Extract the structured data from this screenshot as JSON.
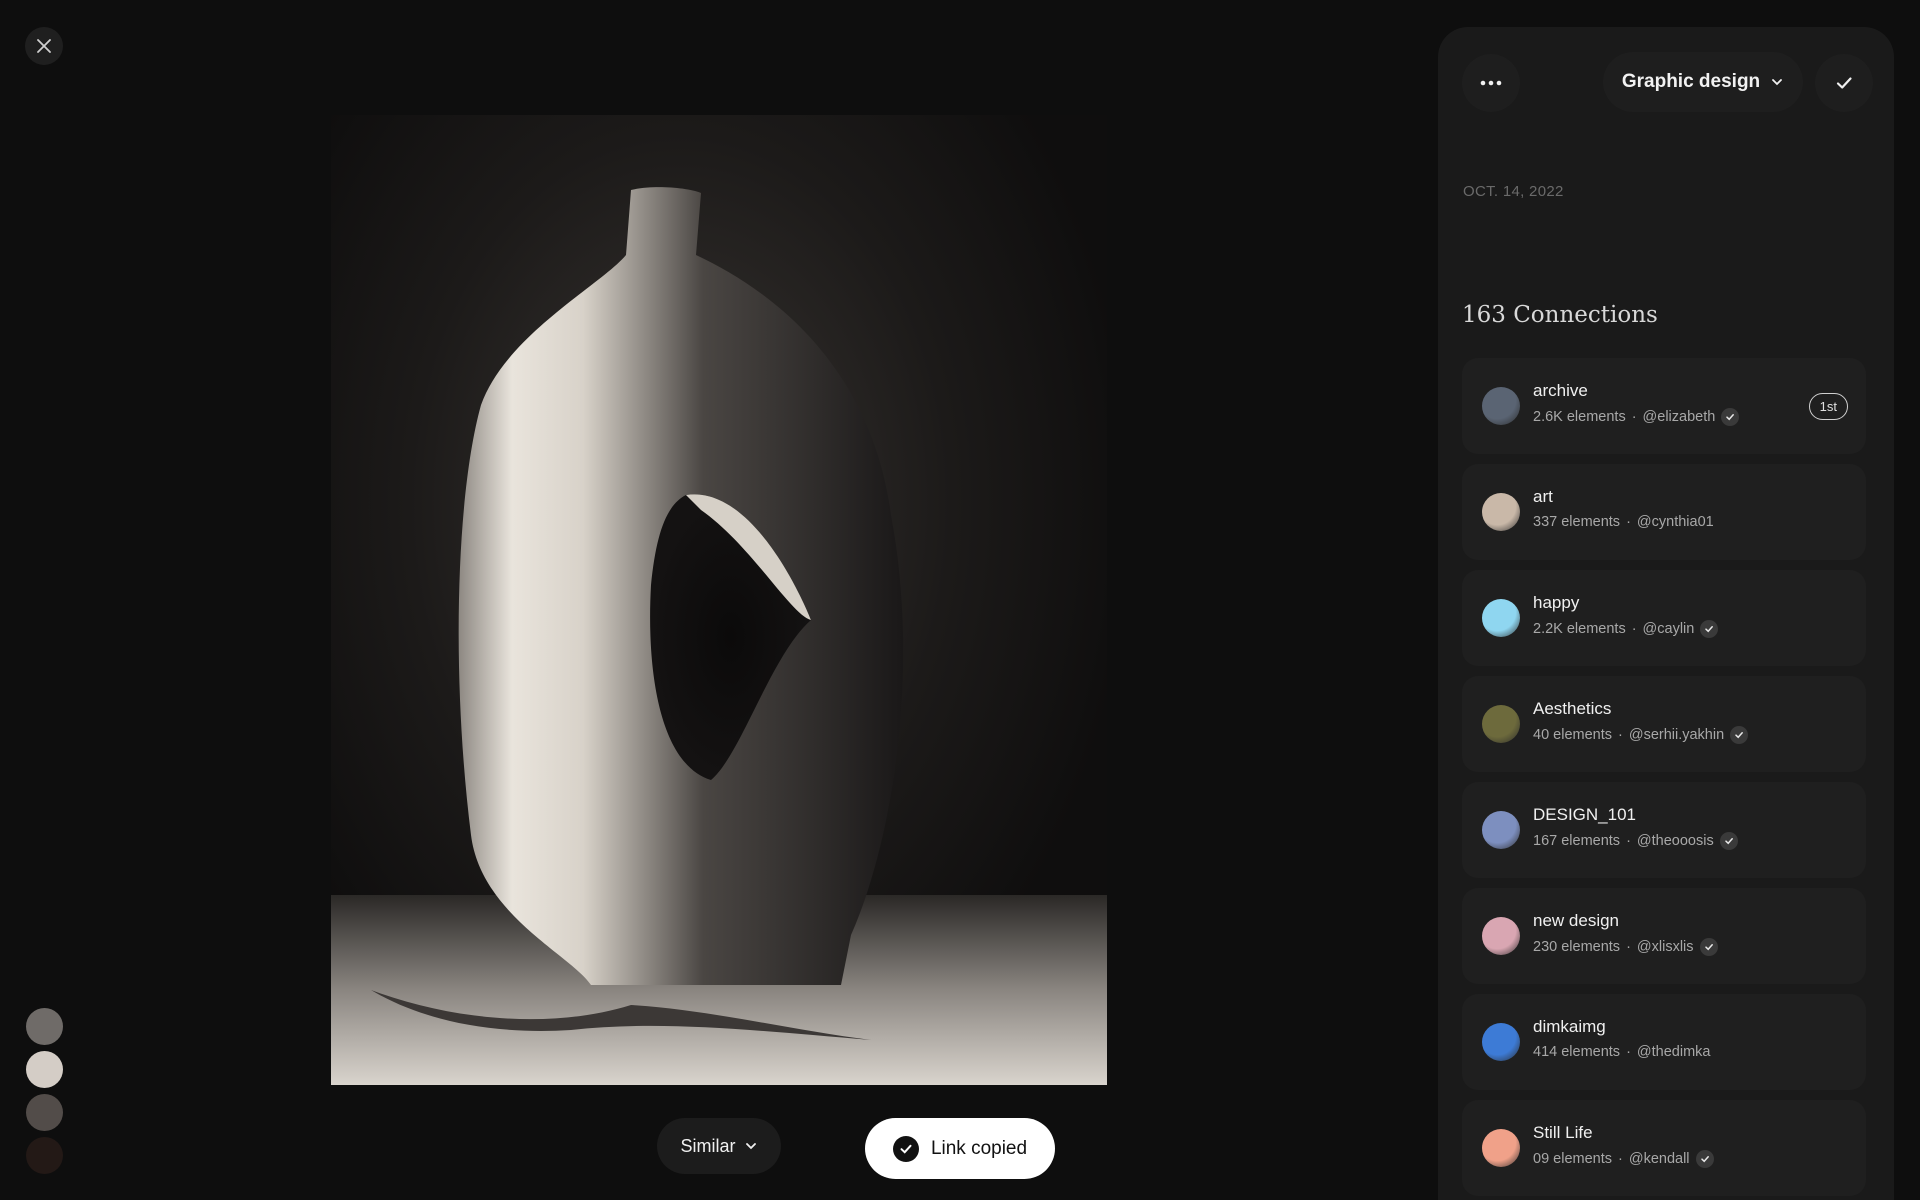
{
  "viewer": {
    "close_icon": "close-icon",
    "swatches": [
      "#6f6b68",
      "#d4cdc6",
      "#524c49",
      "#231916"
    ]
  },
  "actions": {
    "similar_label": "Similar",
    "toast_label": "Link copied"
  },
  "panel": {
    "board_label": "Graphic design",
    "date": "OCT. 14, 2022",
    "connections_heading": "163 Connections",
    "connections": [
      {
        "title": "archive",
        "count": "2.6K elements",
        "user": "@elizabeth",
        "verified": true,
        "badge": "1st",
        "avatar_color": "#5a6473"
      },
      {
        "title": "art",
        "count": "337 elements",
        "user": "@cynthia01",
        "verified": false,
        "badge": "",
        "avatar_color": "#c9b8a8"
      },
      {
        "title": "happy",
        "count": "2.2K elements",
        "user": "@caylin",
        "verified": true,
        "badge": "",
        "avatar_color": "#8fd6f0"
      },
      {
        "title": "Aesthetics",
        "count": "40 elements",
        "user": "@serhii.yakhin",
        "verified": true,
        "badge": "",
        "avatar_color": "#6d6a3c"
      },
      {
        "title": "DESIGN_101",
        "count": "167 elements",
        "user": "@theooosis",
        "verified": true,
        "badge": "",
        "avatar_color": "#7d8fbf"
      },
      {
        "title": "new design",
        "count": "230 elements",
        "user": "@xlisxlis",
        "verified": true,
        "badge": "",
        "avatar_color": "#d9a6b2"
      },
      {
        "title": "dimkaimg",
        "count": "414 elements",
        "user": "@thedimka",
        "verified": false,
        "badge": "",
        "avatar_color": "#3d7bd6"
      },
      {
        "title": "Still Life",
        "count": "09 elements",
        "user": "@kendall",
        "verified": true,
        "badge": "",
        "avatar_color": "#f0a189"
      }
    ]
  }
}
